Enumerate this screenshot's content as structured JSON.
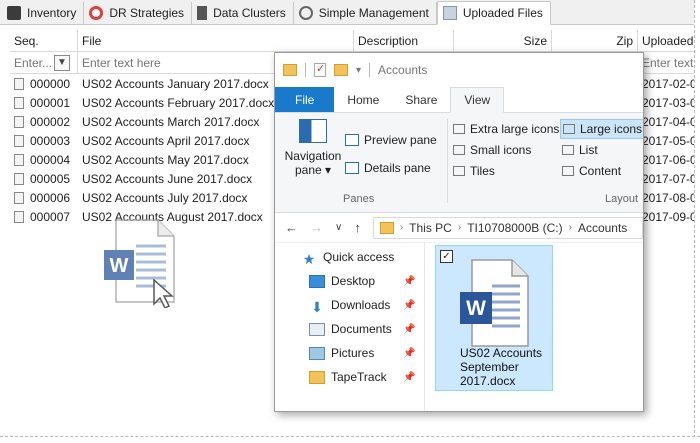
{
  "tabs": [
    {
      "label": "Inventory",
      "icon": "inventory-icon"
    },
    {
      "label": "DR Strategies",
      "icon": "lifebuoy-icon"
    },
    {
      "label": "Data Clusters",
      "icon": "cluster-icon"
    },
    {
      "label": "Simple Management",
      "icon": "gear-icon"
    },
    {
      "label": "Uploaded Files",
      "icon": "uploaded-files-icon",
      "active": true
    }
  ],
  "grid": {
    "columns": [
      "Seq.",
      "File",
      "Description",
      "Size",
      "Zip",
      "Uploaded"
    ],
    "filter_placeholder_seq": "Enter...",
    "filter_placeholder": "Enter text here",
    "filter_placeholder_uploaded": "Enter text",
    "rows": [
      {
        "seq": "000000",
        "file": "US02 Accounts January 2017.docx",
        "uploaded": "2017-02-0"
      },
      {
        "seq": "000001",
        "file": "US02 Accounts February 2017.docx",
        "uploaded": "2017-03-0"
      },
      {
        "seq": "000002",
        "file": "US02 Accounts March 2017.docx",
        "uploaded": "2017-04-0"
      },
      {
        "seq": "000003",
        "file": "US02 Accounts April 2017.docx",
        "uploaded": "2017-05-0"
      },
      {
        "seq": "000004",
        "file": "US02 Accounts May 2017.docx",
        "uploaded": "2017-06-0"
      },
      {
        "seq": "000005",
        "file": "US02 Accounts June 2017.docx",
        "uploaded": "2017-07-0"
      },
      {
        "seq": "000006",
        "file": "US02 Accounts July 2017.docx",
        "uploaded": "2017-08-0"
      },
      {
        "seq": "000007",
        "file": "US02 Accounts August 2017.docx",
        "uploaded": "2017-09-0"
      }
    ]
  },
  "explorer": {
    "title": "Accounts",
    "ribbon_tabs": [
      "File",
      "Home",
      "Share",
      "View"
    ],
    "active_tab": "View",
    "panes": {
      "navigation_pane": "Navigation pane",
      "navigation_pane_line1": "Navigation",
      "navigation_pane_line2": "pane ▾",
      "preview_pane": "Preview pane",
      "details_pane": "Details pane",
      "group": "Panes"
    },
    "layout": {
      "items": [
        "Extra large icons",
        "Large icons",
        "Small icons",
        "List",
        "Tiles",
        "Content"
      ],
      "selected": "Large icons",
      "group": "Layout"
    },
    "address": {
      "crumbs": [
        "This PC",
        "TI10708000B (C:)",
        "Accounts"
      ]
    },
    "nav_tree": [
      {
        "label": "Quick access",
        "icon": "star-icon",
        "pinned": false
      },
      {
        "label": "Desktop",
        "icon": "desktop-icon",
        "pinned": true
      },
      {
        "label": "Downloads",
        "icon": "downloads-icon",
        "pinned": true
      },
      {
        "label": "Documents",
        "icon": "documents-icon",
        "pinned": true
      },
      {
        "label": "Pictures",
        "icon": "pictures-icon",
        "pinned": true
      },
      {
        "label": "TapeTrack",
        "icon": "folder-icon",
        "pinned": true
      }
    ],
    "file_item": {
      "name": "US02 Accounts September 2017.docx",
      "name_line1": "US02 Accounts",
      "name_line2": "September",
      "name_line3": "2017.docx",
      "selected": true
    }
  },
  "colors": {
    "word_blue": "#2b579a",
    "file_tab_blue": "#1979ca",
    "selection": "#cce8ff"
  }
}
